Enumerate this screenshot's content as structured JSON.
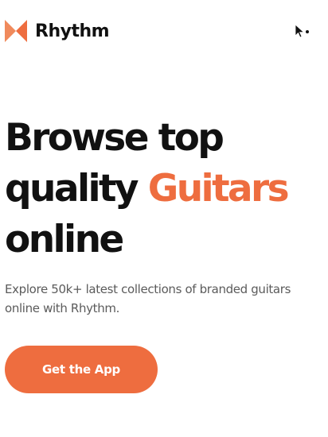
{
  "brand": {
    "name": "Rhythm",
    "logo_icon": "bowtie-logo-icon",
    "accent_color": "#ee6d3f"
  },
  "header": {
    "menu_icon": "menu-toggle-icon"
  },
  "hero": {
    "title_line1": "Browse top",
    "title_line2_plain": "quality ",
    "title_line2_accent": "Guitars",
    "title_line3": "online",
    "subtitle": "Explore 50k+ latest collections of branded guitars online with Rhythm."
  },
  "cta": {
    "label": "Get the App"
  }
}
